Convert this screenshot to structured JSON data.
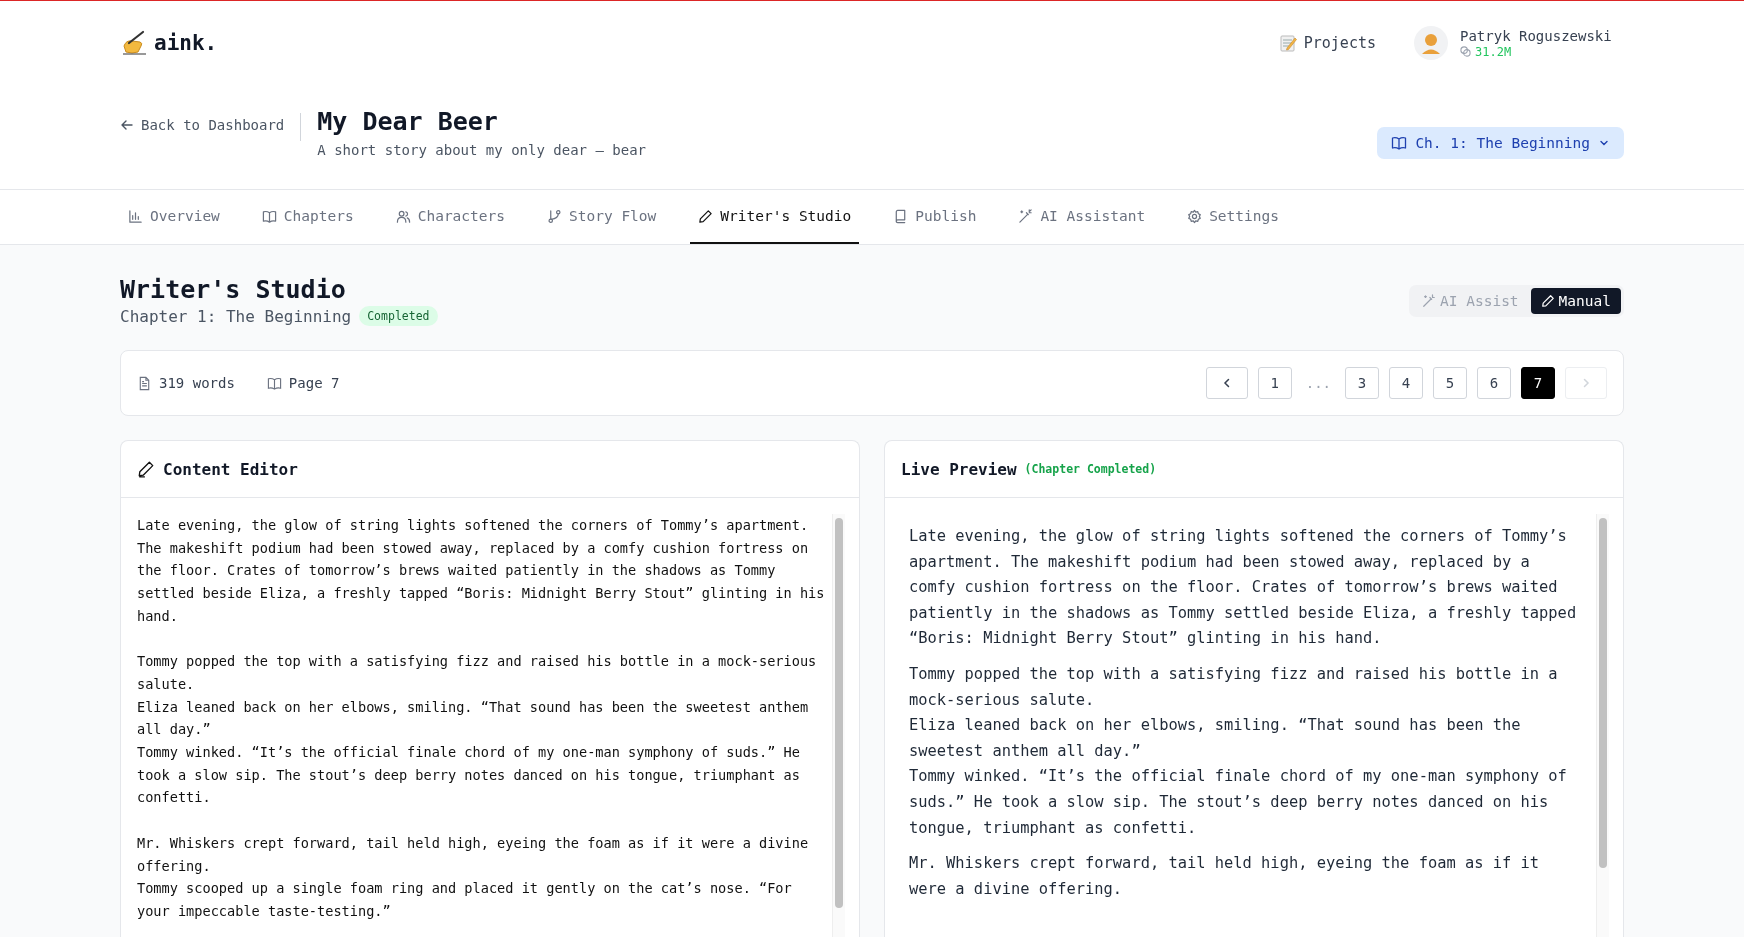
{
  "header": {
    "logo": "aink.",
    "nav_link": "Projects",
    "user": {
      "name": "Patryk Roguszewski",
      "credits": "31.2M"
    }
  },
  "project": {
    "back_link": "Back to Dashboard",
    "title": "My Dear Beer",
    "subtitle": "A short story about my only dear – bear",
    "chapter_select": "Ch. 1: The Beginning"
  },
  "tabs": [
    {
      "label": "Overview",
      "selected": false
    },
    {
      "label": "Chapters",
      "selected": false
    },
    {
      "label": "Characters",
      "selected": false
    },
    {
      "label": "Story Flow",
      "selected": false
    },
    {
      "label": "Writer's Studio",
      "selected": true
    },
    {
      "label": "Publish",
      "selected": false
    },
    {
      "label": "AI Assistant",
      "selected": false
    },
    {
      "label": "Settings",
      "selected": false
    }
  ],
  "studio": {
    "title": "Writer's Studio",
    "chapter": "Chapter 1: The Beginning",
    "status": "Completed",
    "modes": [
      {
        "label": "AI Assist",
        "selected": false
      },
      {
        "label": "Manual",
        "selected": true
      }
    ]
  },
  "stats": {
    "words": "319 words",
    "page": "Page 7"
  },
  "pagination": [
    {
      "kind": "prev",
      "disabled": false
    },
    {
      "kind": "page",
      "label": "1",
      "selected": false
    },
    {
      "kind": "ellipsis",
      "label": "..."
    },
    {
      "kind": "page",
      "label": "3",
      "selected": false
    },
    {
      "kind": "page",
      "label": "4",
      "selected": false
    },
    {
      "kind": "page",
      "label": "5",
      "selected": false
    },
    {
      "kind": "page",
      "label": "6",
      "selected": false
    },
    {
      "kind": "page",
      "label": "7",
      "selected": true
    },
    {
      "kind": "next",
      "disabled": true
    }
  ],
  "editor": {
    "title": "Content Editor",
    "value": "Late evening, the glow of string lights softened the corners of Tommy’s apartment. The makeshift podium had been stowed away, replaced by a comfy cushion fortress on the floor. Crates of tomorrow’s brews waited patiently in the shadows as Tommy settled beside Eliza, a freshly tapped “Boris: Midnight Berry Stout” glinting in his hand.\n\nTommy popped the top with a satisfying fizz and raised his bottle in a mock-serious salute.\nEliza leaned back on her elbows, smiling. “That sound has been the sweetest anthem all day.”\nTommy winked. “It’s the official finale chord of my one-man symphony of suds.” He took a slow sip. The stout’s deep berry notes danced on his tongue, triumphant as confetti.\n\nMr. Whiskers crept forward, tail held high, eyeing the foam as if it were a divine offering.\nTommy scooped up a single foam ring and placed it gently on the cat’s nose. “For your impeccable taste-testing.”"
  },
  "preview": {
    "title": "Live Preview",
    "note": "(Chapter Completed)",
    "paragraphs": [
      [
        "Late evening, the glow of string lights softened the corners of Tommy’s apartment. The makeshift podium had been stowed away, replaced by a comfy cushion fortress on the floor. Crates of tomorrow’s brews waited patiently in the shadows as Tommy settled beside Eliza, a freshly tapped “Boris: Midnight Berry Stout” glinting in his hand."
      ],
      [
        "Tommy popped the top with a satisfying fizz and raised his bottle in a mock-serious salute.",
        "Eliza leaned back on her elbows, smiling. “That sound has been the sweetest anthem all day.”",
        "Tommy winked. “It’s the official finale chord of my one-man symphony of suds.” He took a slow sip. The stout’s deep berry notes danced on his tongue, triumphant as confetti."
      ],
      [
        "Mr. Whiskers crept forward, tail held high, eyeing the foam as if it were a divine offering."
      ]
    ]
  }
}
